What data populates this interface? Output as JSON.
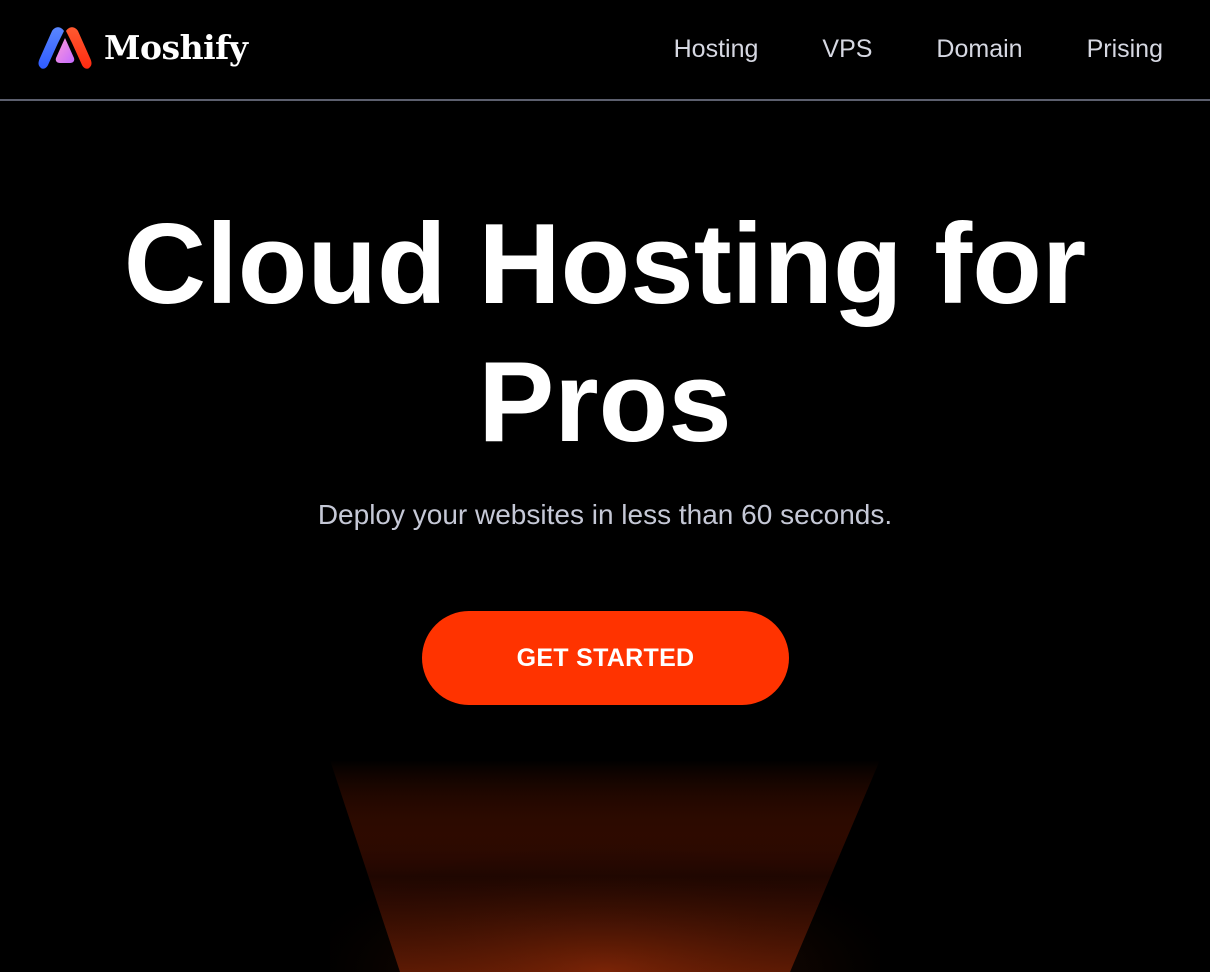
{
  "brand": {
    "name": "Moshify",
    "logo_icon": "moshify-logo-icon",
    "logo_colors": [
      "#3b6cff",
      "#ff3d1f",
      "#e86bff"
    ]
  },
  "nav": {
    "links": [
      {
        "label": "Hosting"
      },
      {
        "label": "VPS"
      },
      {
        "label": "Domain"
      },
      {
        "label": "Prising"
      }
    ]
  },
  "hero": {
    "title_line1": "Cloud Hosting for",
    "title_line2": "Pros",
    "subtitle": "Deploy your websites in less than 60 seconds.",
    "cta_label": "GET STARTED"
  },
  "colors": {
    "background": "#000000",
    "accent": "#ff3300",
    "nav_text": "#d6d8e2",
    "subtitle_text": "#c5c8d6",
    "divider": "#5c5f6e"
  }
}
